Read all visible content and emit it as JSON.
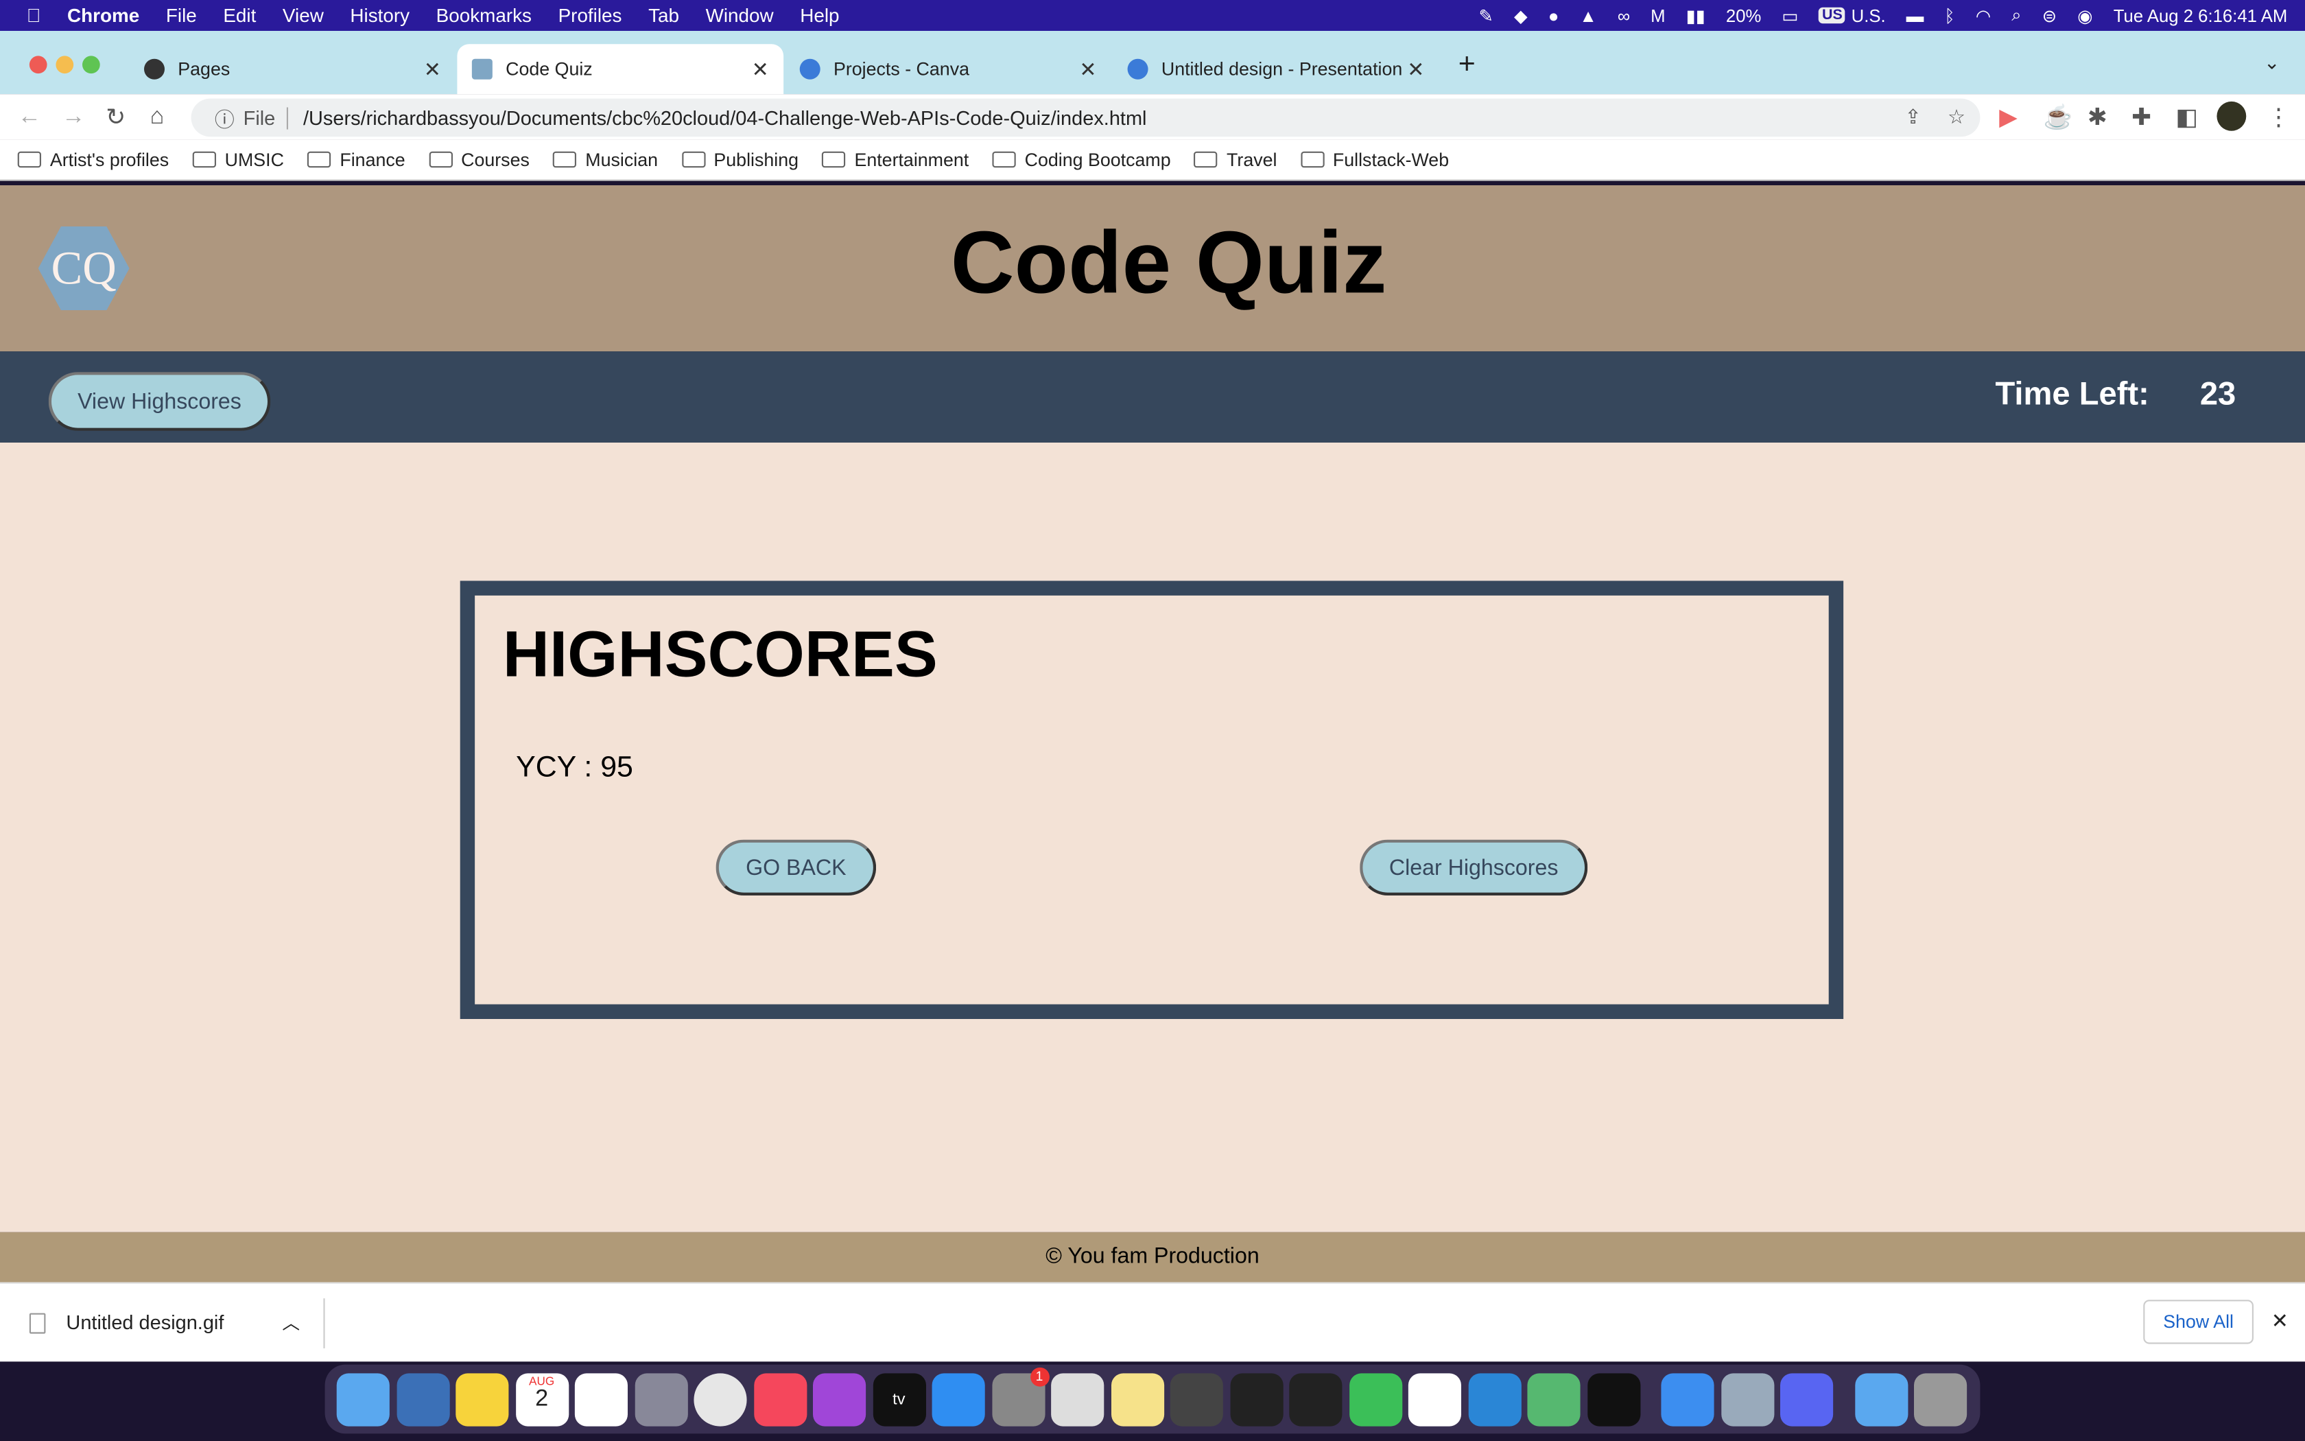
{
  "menubar": {
    "app": "Chrome",
    "items": [
      "File",
      "Edit",
      "View",
      "History",
      "Bookmarks",
      "Profiles",
      "Tab",
      "Window",
      "Help"
    ],
    "battery": "20%",
    "input_source": "U.S.",
    "input_badge": "US",
    "datetime": "Tue Aug 2  6:16:41 AM"
  },
  "tabs": [
    {
      "label": "Pages",
      "active": false
    },
    {
      "label": "Code Quiz",
      "active": true
    },
    {
      "label": "Projects - Canva",
      "active": false
    },
    {
      "label": "Untitled design - Presentation",
      "active": false
    }
  ],
  "address": {
    "scheme_label": "File",
    "url": "/Users/richardbassyou/Documents/cbc%20cloud/04-Challenge-Web-APIs-Code-Quiz/index.html"
  },
  "bookmarks": [
    "Artist's profiles",
    "UMSIC",
    "Finance",
    "Courses",
    "Musician",
    "Publishing",
    "Entertainment",
    "Coding Bootcamp",
    "Travel",
    "Fullstack-Web"
  ],
  "page": {
    "logo": "CQ",
    "title": "Code Quiz",
    "view_highscores": "View Highscores",
    "time_label": "Time Left:",
    "time_value": "23",
    "highscores_title": "HIGHSCORES",
    "scores": [
      "YCY : 95"
    ],
    "go_back": "GO BACK",
    "clear": "Clear Highscores",
    "footer": "© You fam Production"
  },
  "download": {
    "file": "Untitled design.gif",
    "show_all": "Show All"
  },
  "dock": {
    "calendar_month": "AUG",
    "calendar_day": "2",
    "badge": "1"
  },
  "colors": {
    "header": "#ae977f",
    "nav": "#36475c",
    "main": "#f3e2d6",
    "button": "#a8d2dc",
    "footer": "#b09a78"
  }
}
